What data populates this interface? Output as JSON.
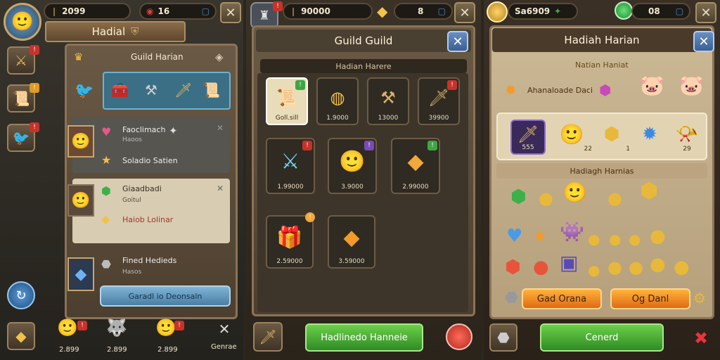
{
  "left": {
    "top_value": "2099",
    "gem_value": "16",
    "header": "Hadial",
    "panel_title": "Guild Harian",
    "items": [
      {
        "title": "Faoclimach",
        "sub": "Haoos",
        "extra": "Soladio Satien"
      },
      {
        "title": "Giaadbadi",
        "sub": "Goitul",
        "extra": "Haiob Lolinar"
      },
      {
        "title": "Fined Hedieds",
        "sub": "Hasos"
      }
    ],
    "action_button": "Garadl io Deonsaln",
    "bottom": {
      "values": [
        "2.899",
        "2.899",
        "2.899"
      ],
      "genre": "Genrae"
    }
  },
  "middle": {
    "top_value": "90000",
    "gem_value": "8",
    "title": "Guild Guild",
    "subheader": "Hadian Harere",
    "tiles": [
      {
        "label": "Goll.sill",
        "icon": "scroll-icon",
        "badge": "g"
      },
      {
        "label": "1.9000",
        "icon": "coin-bag-icon"
      },
      {
        "label": "13000",
        "icon": "axe-icon"
      },
      {
        "label": "39900",
        "icon": "dagger-icon",
        "badge": "r"
      },
      {
        "label": "1.99000",
        "icon": "crystal-sword-icon",
        "badge": "r"
      },
      {
        "label": "3.9000",
        "icon": "hero-portrait-icon",
        "badge": "p"
      },
      {
        "label": "2.99000",
        "icon": "gold-crystal-icon",
        "badge": "g"
      },
      {
        "label": "2.59000",
        "icon": "red-chest-icon",
        "badge": "o"
      },
      {
        "label": "3.59000",
        "icon": "fire-crystal-icon"
      }
    ],
    "green_button": "Hadlinedo Hanneie"
  },
  "right": {
    "top_value": "Sa6909",
    "gem_value": "08",
    "title": "Hadiah Harian",
    "section1": "Natian Haniat",
    "row1_text": "Ahanaloade Daci",
    "featured": [
      {
        "label": "555",
        "icon": "staff-icon"
      },
      {
        "label": "22",
        "icon": "heroine-icon"
      },
      {
        "label": "1",
        "icon": "gold-flask-icon"
      },
      {
        "label": "",
        "icon": "blue-gem-icon"
      },
      {
        "label": "29",
        "icon": "horn-icon"
      }
    ],
    "section2": "Hadiagh Harnias",
    "orange_btn1": "Gad Orana",
    "orange_btn2": "Og Danl",
    "green_button": "Cenerd"
  }
}
